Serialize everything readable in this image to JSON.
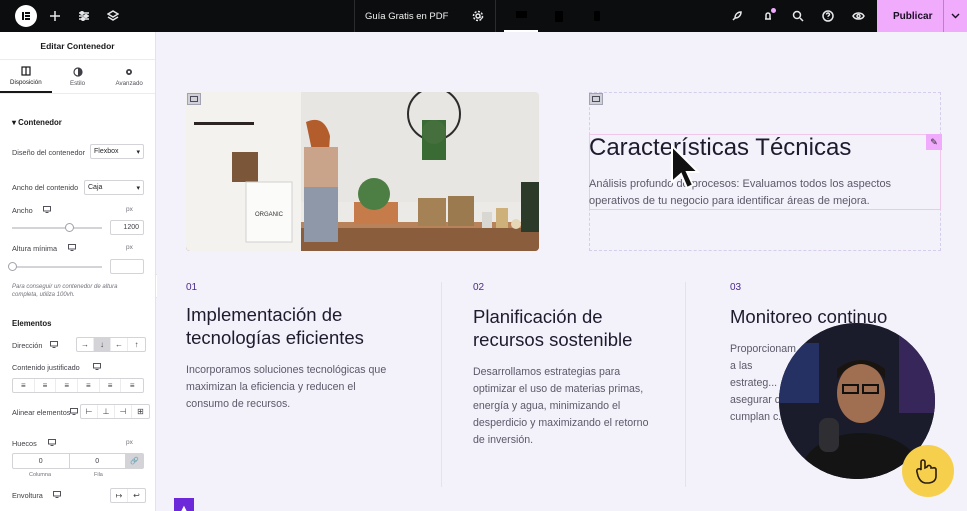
{
  "topbar": {
    "document_title": "Guía Gratis en PDF",
    "publish_label": "Publicar"
  },
  "panel": {
    "title": "Editar Contenedor",
    "tabs": [
      {
        "label": "Disposición",
        "icon": "layout-icon",
        "active": true
      },
      {
        "label": "Estilo",
        "icon": "contrast-icon",
        "active": false
      },
      {
        "label": "Avanzado",
        "icon": "gear-icon",
        "active": false
      }
    ],
    "section_contenedor": "Contenedor",
    "diseno_label": "Diseño del contenedor",
    "diseno_value": "Flexbox",
    "ancho_contenido_label": "Ancho del contenido",
    "ancho_contenido_value": "Caja",
    "ancho_label": "Ancho",
    "ancho_unit": "px",
    "ancho_value": "1200",
    "altura_label": "Altura mínima",
    "altura_unit": "px",
    "altura_value": "",
    "note": "Para conseguir un contenedor de altura completa, utiliza 100vh.",
    "section_elementos": "Elementos",
    "direccion_label": "Dirección",
    "contenido_justificado_label": "Contenido justificado",
    "alinear_label": "Alinear elementos",
    "huecos_label": "Huecos",
    "huecos_unit": "px",
    "huecos_columna": "0",
    "huecos_fila": "0",
    "columna_label": "Columna",
    "fila_label": "Fila",
    "envoltura_label": "Envoltura"
  },
  "canvas": {
    "heading": "Características Técnicas",
    "description": "Análisis profundo de procesos: Evaluamos todos los aspectos operativos de tu negocio para identificar áreas de mejora.",
    "columns": [
      {
        "number": "01",
        "title": "Implementación de tecnologías eficientes",
        "text": "Incorporamos soluciones tecnológicas que maximizan la eficiencia y reducen el consumo de recursos."
      },
      {
        "number": "02",
        "title": "Planificación de recursos sostenible",
        "text": "Desarrollamos estrategias para optimizar el uso de materias primas, energía y agua, minimizando el desperdicio y maximizando el retorno de inversión."
      },
      {
        "number": "03",
        "title": "Monitoreo continuo",
        "text": "Proporcionam... a las estrateg... asegurar c... cumplan c..."
      }
    ],
    "photo_label": "ORGANIC"
  },
  "colors": {
    "accent": "#f0abfc",
    "number_purple": "#4b2a8b",
    "canvas_bg": "#f3f1fa"
  }
}
